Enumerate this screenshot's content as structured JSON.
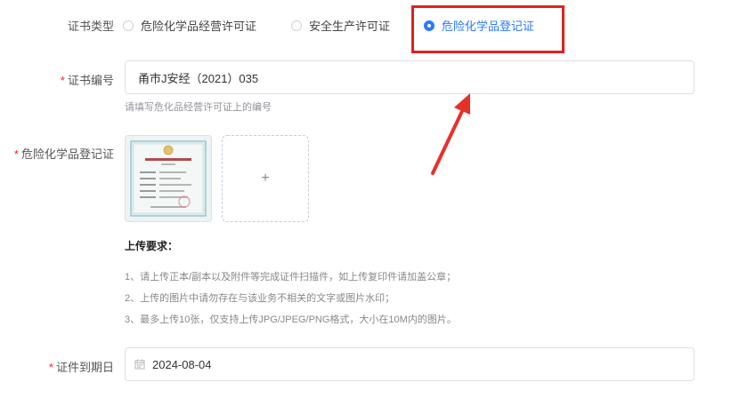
{
  "cert_type": {
    "label": "证书类型",
    "options": [
      {
        "label": "危险化学品经营许可证",
        "selected": false
      },
      {
        "label": "安全生产许可证",
        "selected": false
      },
      {
        "label": "危险化学品登记证",
        "selected": true
      }
    ]
  },
  "cert_number": {
    "required_mark": "*",
    "label": "证书编号",
    "value": "甬市J安经（2021）035",
    "hint": "请填写危化品经营许可证上的编号"
  },
  "registration_cert": {
    "required_mark": "*",
    "label": "危险化学品登记证",
    "add_symbol": "+"
  },
  "upload_requirements": {
    "title": "上传要求：",
    "lines": [
      "1、请上传正本/副本以及附件等完成证件扫描件，如上传复印件请加盖公章；",
      "2、上传的图片中请勿存在与该业务不相关的文字或图片水印；",
      "3、最多上传10张，仅支持上传JPG/JPEG/PNG格式，大小在10M内的图片。"
    ]
  },
  "expiry": {
    "required_mark": "*",
    "label": "证件到期日",
    "value": "2024-08-04",
    "icon": "calendar-icon"
  },
  "colors": {
    "primary": "#2b7bf6",
    "required": "#f5222d",
    "annotation": "#e02020"
  }
}
